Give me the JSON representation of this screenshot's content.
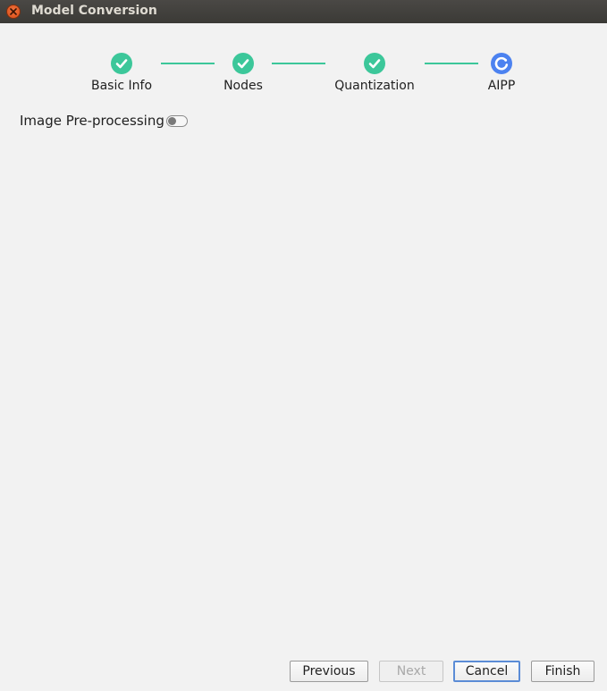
{
  "window": {
    "title": "Model Conversion"
  },
  "stepper": {
    "steps": [
      {
        "label": "Basic Info",
        "state": "done",
        "icon": "check-icon"
      },
      {
        "label": "Nodes",
        "state": "done",
        "icon": "check-icon"
      },
      {
        "label": "Quantization",
        "state": "done",
        "icon": "check-icon"
      },
      {
        "label": "AIPP",
        "state": "in-progress",
        "icon": "loading-icon"
      }
    ],
    "colors": {
      "done": "#3cc79a",
      "current": "#4c82f0"
    }
  },
  "settings": {
    "image_preprocessing_label": "Image Pre-processing",
    "image_preprocessing_enabled": false
  },
  "footer": {
    "previous_label": "Previous",
    "next_label": "Next",
    "cancel_label": "Cancel",
    "finish_label": "Finish"
  }
}
